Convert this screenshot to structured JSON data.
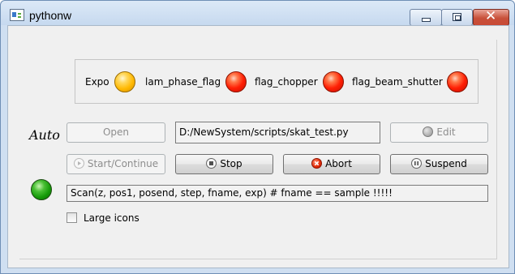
{
  "window": {
    "title": "pythonw",
    "icon": "python-app-icon"
  },
  "status": {
    "items": [
      {
        "label": "Expo",
        "color": "#FFB800"
      },
      {
        "label": "lam_phase_flag",
        "color": "#FF1F05"
      },
      {
        "label": "flag_chopper",
        "color": "#FF1F05"
      },
      {
        "label": "flag_beam_shutter",
        "color": "#FF1F05"
      }
    ]
  },
  "controls": {
    "mode_label": "Auto",
    "open_label": "Open",
    "script_path": "D:/NewSystem/scripts/skat_test.py",
    "edit_label": "Edit",
    "start_label": "Start/Continue",
    "stop_label": "Stop",
    "abort_label": "Abort",
    "suspend_label": "Suspend",
    "run_state_color": "#159A08",
    "command": "Scan(z, pos1, posend, step, fname, exp) # fname == sample !!!!!",
    "large_icons_label": "Large icons",
    "large_icons_checked": false
  }
}
